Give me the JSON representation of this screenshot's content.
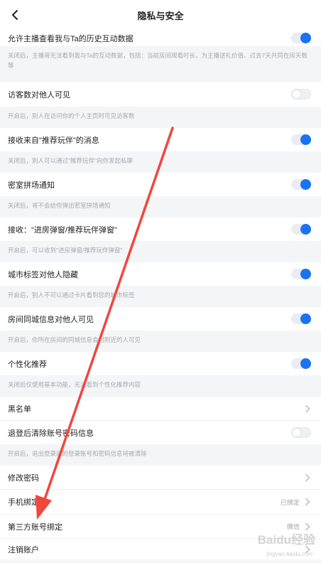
{
  "header": {
    "title": "隐私与安全"
  },
  "settings": [
    {
      "label": "允许主播查看我与Ta的历史互动数据",
      "desc": "关闭后，主播将无法看到我与Ta的互动数据，包括：当前房间观看时长、为主播送礼价值、过去7天共同在房天数等",
      "toggle": "on"
    },
    {
      "label": "访客数对他人可见",
      "desc": "开启后，别人在访问你的个人主页时可见访客数",
      "toggle": "off"
    },
    {
      "label": "接收来自\"推荐玩伴\"的消息",
      "desc": "关闭后，别人可以通过\"推荐玩伴\"向你发起私聊",
      "toggle": "on"
    },
    {
      "label": "密室拼场通知",
      "desc": "关闭后，将不会给你弹出密室拼场通知",
      "toggle": "on"
    },
    {
      "label": "接收：\"进房弹窗/推荐玩伴弹窗\"",
      "desc": "开启后，可以收到\"进房弹窗/推荐玩伴弹窗\"",
      "toggle": "on"
    },
    {
      "label": "城市标签对他人隐藏",
      "desc": "开启后，别人不可以通过卡片看到您的城市标签",
      "toggle": "on"
    },
    {
      "label": "房间同城信息对他人可见",
      "desc": "开启后，你所在房间的同城信息会对附近的人可见",
      "toggle": "on"
    },
    {
      "label": "个性化推荐",
      "desc": "关闭后仅使用基本功能，无法看到个性化推荐内容",
      "toggle": "on"
    },
    {
      "label": "黑名单",
      "desc": "",
      "toggle": "none"
    },
    {
      "label": "退登后清除账号密码信息",
      "desc": "开启后，退出登录后的登录账号和密码信息将被清除",
      "toggle": "off"
    }
  ],
  "links": [
    {
      "label": "修改密码",
      "status": ""
    },
    {
      "label": "手机绑定",
      "status": "已绑定"
    },
    {
      "label": "第三方账号绑定",
      "status": "微信"
    },
    {
      "label": "注销账户",
      "status": ""
    }
  ],
  "watermark": {
    "brand": "Baidu经验",
    "url": "jingyan.baidu.com"
  },
  "colors": {
    "accent": "#1a73f0",
    "annotation_arrow": "#f0473d"
  },
  "icons": {
    "back": "chevron-left-icon",
    "row_arrow": "chevron-right-icon"
  }
}
